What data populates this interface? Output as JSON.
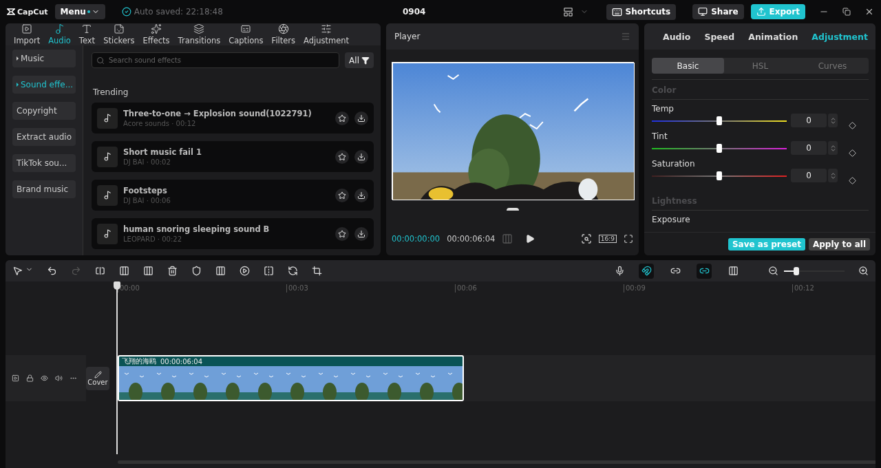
{
  "title_bar": {
    "logo": "CapCut",
    "menu": "Menu",
    "autosave": "Auto saved: 22:18:48",
    "project": "0904",
    "shortcuts": "Shortcuts",
    "share": "Share",
    "export": "Export"
  },
  "media_tabs": [
    {
      "label": "Import",
      "selected": false
    },
    {
      "label": "Audio",
      "selected": true
    },
    {
      "label": "Text",
      "selected": false
    },
    {
      "label": "Stickers",
      "selected": false
    },
    {
      "label": "Effects",
      "selected": false
    },
    {
      "label": "Transitions",
      "selected": false
    },
    {
      "label": "Captions",
      "selected": false
    },
    {
      "label": "Filters",
      "selected": false
    },
    {
      "label": "Adjustment",
      "selected": false
    }
  ],
  "categories": [
    {
      "label": "Music",
      "selected": false,
      "expandable": true
    },
    {
      "label": "Sound effe...",
      "selected": true,
      "expandable": true
    },
    {
      "label": "Copyright",
      "selected": false,
      "expandable": false
    },
    {
      "label": "Extract audio",
      "selected": false,
      "expandable": false
    },
    {
      "label": "TikTok sou...",
      "selected": false,
      "expandable": false
    },
    {
      "label": "Brand music",
      "selected": false,
      "expandable": false
    }
  ],
  "search": {
    "placeholder": "Search sound effects"
  },
  "filter": "All",
  "section": "Trending",
  "sounds": [
    {
      "title": "Three-to-one → Explosion sound(1022791)",
      "meta": "Acore sounds · 00:12"
    },
    {
      "title": "Short music fail 1",
      "meta": "DJ BAI · 00:02"
    },
    {
      "title": "Footsteps",
      "meta": "DJ BAI · 00:06"
    },
    {
      "title": "human snoring sleeping sound B",
      "meta": "LEOPARD · 00:22"
    }
  ],
  "player": {
    "title": "Player",
    "current": "00:00:00:00",
    "total": "00:00:06:04",
    "ratio": "16:9"
  },
  "inspector": {
    "tabs": [
      {
        "label": "Audio",
        "selected": false
      },
      {
        "label": "Speed",
        "selected": false
      },
      {
        "label": "Animation",
        "selected": false
      },
      {
        "label": "Adjustment",
        "selected": true
      }
    ],
    "subtabs": [
      {
        "label": "Basic",
        "selected": true
      },
      {
        "label": "HSL",
        "selected": false
      },
      {
        "label": "Curves",
        "selected": false
      }
    ],
    "section": "Color",
    "sliders": [
      {
        "label": "Temp",
        "level": 0.5,
        "value": "0"
      },
      {
        "label": "Tint",
        "level": 0.5,
        "value": "0"
      },
      {
        "label": "Saturation",
        "level": 0.5,
        "value": "0"
      }
    ],
    "section2": "Lightness",
    "next_label": "Exposure",
    "save_preset": "Save as preset",
    "apply_all": "Apply to all"
  },
  "timeline": {
    "toggles": [
      {
        "on": true
      },
      {
        "on": false
      },
      {
        "on": true
      },
      {
        "on": false
      }
    ],
    "zoom": {
      "level": 0.2
    },
    "ticks": [
      "00:00",
      "00:03",
      "00:06",
      "00:09",
      "00:12"
    ],
    "cover": "Cover",
    "clip": {
      "name": "飞翔的海鸥",
      "duration": "00:00:06:04"
    }
  }
}
